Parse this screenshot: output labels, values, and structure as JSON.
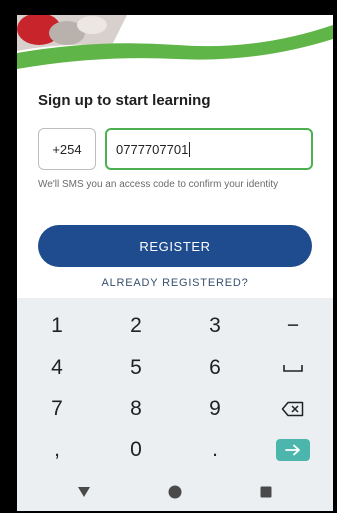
{
  "signup": {
    "heading": "Sign up to start learning",
    "country_code": "+254",
    "phone_value": "0777707701",
    "helper_text": "We'll SMS you an access code to confirm your identity",
    "register_label": "REGISTER",
    "already_label": "ALREADY REGISTERED?"
  },
  "keyboard": {
    "row1": [
      "1",
      "2",
      "3",
      "−"
    ],
    "row2": [
      "4",
      "5",
      "6"
    ],
    "row3": [
      "7",
      "8",
      "9"
    ],
    "row4": [
      ",",
      "0",
      "."
    ],
    "icons": [
      "space-icon",
      "backspace-icon",
      "enter-arrow-icon"
    ]
  },
  "navbar": {
    "icons": [
      "back-triangle-icon",
      "home-circle-icon",
      "recents-square-icon"
    ]
  },
  "colors": {
    "brand_blue": "#1e4c8f",
    "input_focus": "#4caf50",
    "enter_key": "#4db6ac",
    "hero_green": "#5fb548"
  }
}
